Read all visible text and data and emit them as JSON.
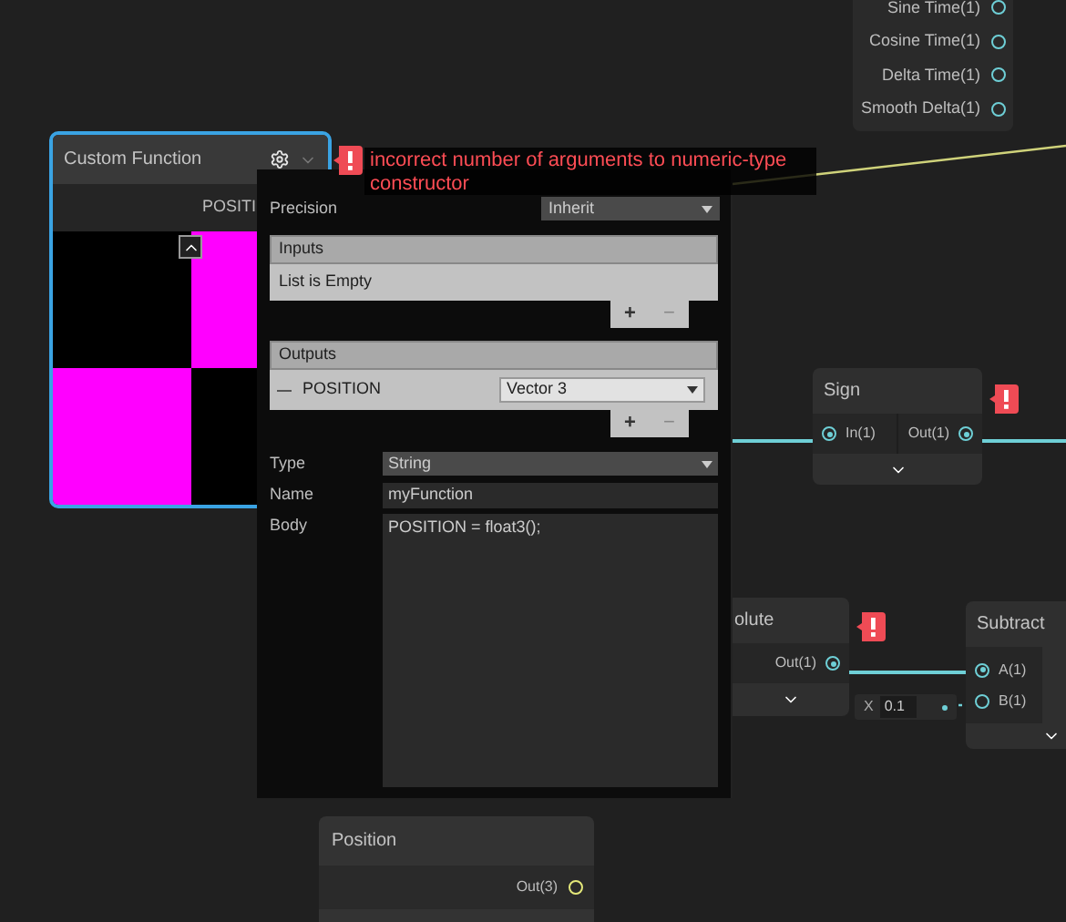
{
  "time_node": {
    "outputs": [
      "Sine Time(1)",
      "Cosine Time(1)",
      "Delta Time(1)",
      "Smooth Delta(1)"
    ]
  },
  "custom_function_node": {
    "title": "Custom Function",
    "output": "POSITI",
    "selected": true
  },
  "error": {
    "message": "incorrect number of arguments to numeric-type constructor"
  },
  "settings_popup": {
    "precision_label": "Precision",
    "precision": "Inherit",
    "inputs": {
      "header": "Inputs",
      "empty_text": "List is Empty",
      "add": "+",
      "remove": "−"
    },
    "outputs": {
      "header": "Outputs",
      "rows": [
        {
          "name": "POSITION",
          "type": "Vector 3"
        }
      ],
      "add": "+",
      "remove": "−"
    },
    "type_label": "Type",
    "type": "String",
    "name_label": "Name",
    "name": "myFunction",
    "body_label": "Body",
    "body": "POSITION = float3();"
  },
  "sign_node": {
    "title": "Sign",
    "input": "In(1)",
    "output": "Out(1)",
    "error": true
  },
  "absolute_node": {
    "title": "olute",
    "output": "Out(1)",
    "error": true
  },
  "subtract_node": {
    "title": "Subtract",
    "inputs": [
      "A(1)",
      "B(1)"
    ]
  },
  "subtract_b_value": {
    "axis": "X",
    "value": "0.1"
  },
  "position_node": {
    "title": "Position",
    "output": "Out(3)"
  }
}
